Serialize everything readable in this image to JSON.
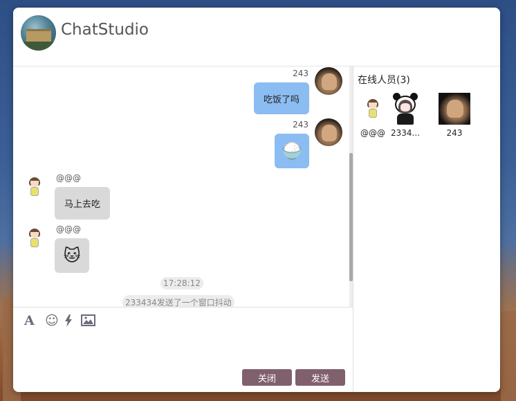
{
  "app": {
    "title": "ChatStudio"
  },
  "messages": [
    {
      "sender": "243",
      "side": "right",
      "type": "text",
      "text": "吃饭了吗"
    },
    {
      "sender": "243",
      "side": "right",
      "type": "emoji",
      "emoji": "🍚"
    },
    {
      "sender": "@@@",
      "side": "left",
      "type": "text",
      "text": "马上去吃"
    },
    {
      "sender": "@@@",
      "side": "left",
      "type": "emoji",
      "emoji": "🐱"
    }
  ],
  "system": {
    "time": "17:28:12",
    "notice": "233434发送了一个窗口抖动"
  },
  "composer": {
    "tools": [
      {
        "name": "font-icon",
        "glyph": "A"
      },
      {
        "name": "emoji-icon",
        "glyph": "☺"
      },
      {
        "name": "shake-icon",
        "glyph": "⚡"
      },
      {
        "name": "image-icon",
        "glyph": "▣"
      }
    ],
    "close_label": "关闭",
    "send_label": "发送"
  },
  "online": {
    "title": "在线人员(3)",
    "users": [
      {
        "name": "@@@"
      },
      {
        "name": "2334..."
      },
      {
        "name": "243"
      }
    ]
  },
  "colors": {
    "mine_bubble": "#8bbcf2",
    "theirs_bubble": "#d9d9d9",
    "button": "#81606d"
  }
}
